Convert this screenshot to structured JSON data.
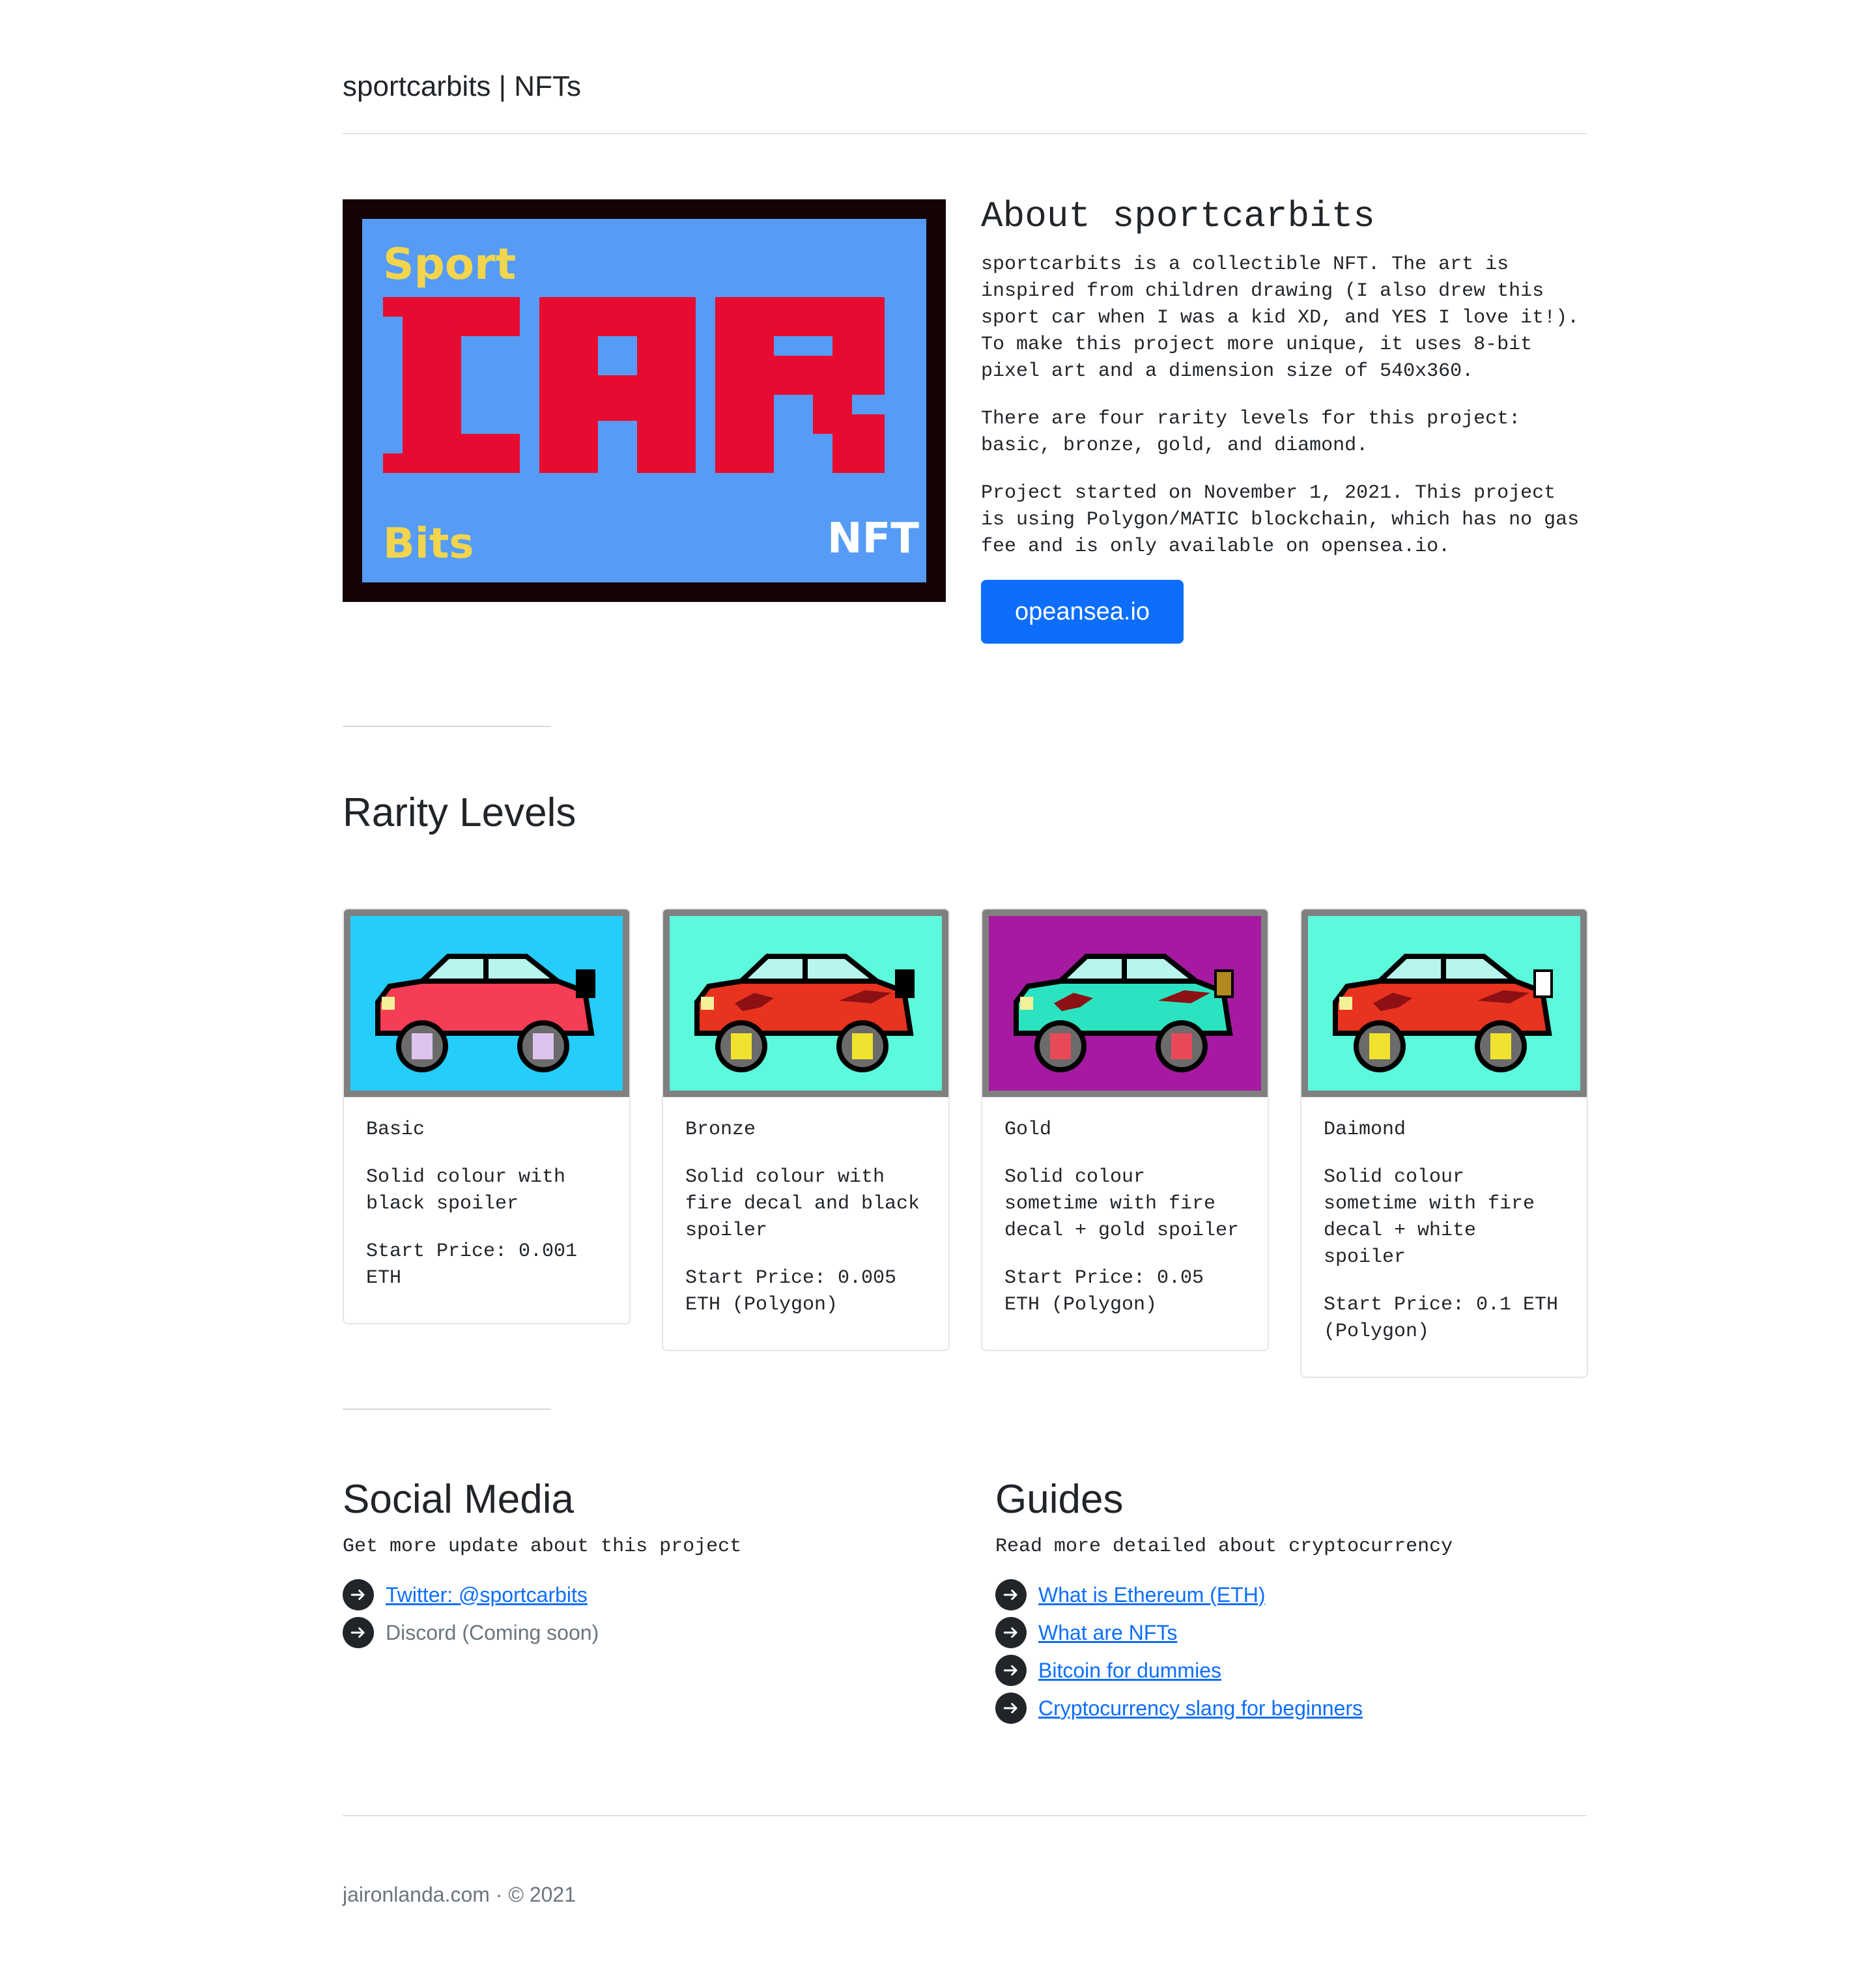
{
  "header": {
    "title": "sportcarbits | NFTs"
  },
  "hero": {
    "logo": {
      "top_text": "Sport",
      "main_text": "CAR",
      "bottom_left_text": "Bits",
      "bottom_right_text": "NFT",
      "bg_color": "#569cf6",
      "frame_color": "#140303",
      "letter_color": "#e80b31",
      "accent_color": "#f2d54c"
    },
    "about_title": "About sportcarbits",
    "paragraphs": [
      "sportcarbits is a collectible NFT. The art is inspired from children drawing (I also drew this sport car when I was a kid XD, and YES I love it!). To make this project more unique, it uses 8-bit pixel art and a dimension size of 540x360.",
      "There are four rarity levels for this project: basic, bronze, gold, and diamond.",
      "Project started on November 1, 2021. This project is using Polygon/MATIC blockchain, which has no gas fee and is only available on opensea.io."
    ],
    "button_label": "opeansea.io"
  },
  "rarity": {
    "heading": "Rarity Levels",
    "cards": [
      {
        "name": "Basic",
        "desc": "Solid colour with black spoiler",
        "price": "Start Price: 0.001 ETH",
        "bg": "#24cdfa",
        "body": "#f53d55",
        "wheel": "#dcc4ee",
        "spoiler": "#000000",
        "decal": false
      },
      {
        "name": "Bronze",
        "desc": "Solid colour with fire decal and black spoiler",
        "price": "Start Price: 0.005 ETH (Polygon)",
        "bg": "#5cfadc",
        "body": "#e8331f",
        "wheel": "#f0e22f",
        "spoiler": "#000000",
        "decal": true
      },
      {
        "name": "Gold",
        "desc": "Solid colour sometime with fire decal + gold spoiler",
        "price": "Start Price: 0.05 ETH (Polygon)",
        "bg": "#a51aa0",
        "body": "#2be3c0",
        "wheel": "#e84a5a",
        "spoiler": "#b08a21",
        "decal": true
      },
      {
        "name": "Daimond",
        "desc": "Solid colour sometime with fire decal + white spoiler",
        "price": "Start Price: 0.1 ETH (Polygon)",
        "bg": "#5cfadc",
        "body": "#e8331f",
        "wheel": "#f0e22f",
        "spoiler": "#ffffff",
        "decal": true
      }
    ]
  },
  "social": {
    "heading": "Social Media",
    "subtitle": "Get more update about this project",
    "links": [
      {
        "label": "Twitter: @sportcarbits",
        "active": true
      },
      {
        "label": "Discord (Coming soon)",
        "active": false
      }
    ]
  },
  "guides": {
    "heading": "Guides",
    "subtitle": "Read more detailed about cryptocurrency",
    "links": [
      {
        "label": "What is Ethereum (ETH)"
      },
      {
        "label": "What are NFTs"
      },
      {
        "label": "Bitcoin for dummies"
      },
      {
        "label": "Cryptocurrency slang for beginners"
      }
    ]
  },
  "footer": {
    "text": "jaironlanda.com · © 2021"
  }
}
